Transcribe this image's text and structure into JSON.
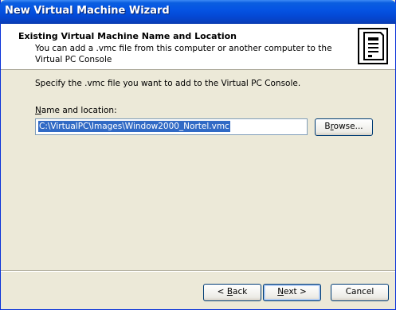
{
  "window": {
    "title": "New Virtual Machine Wizard"
  },
  "header": {
    "title": "Existing Virtual Machine Name and Location",
    "subtitle": "You can add a .vmc file from this computer or another computer to the Virtual PC Console",
    "icon": "computer-tower-icon"
  },
  "main": {
    "instruction": "Specify the .vmc file you want to add to the Virtual PC Console.",
    "field_label": "Name and location:",
    "path_value": "C:\\VirtualPC\\Images\\Window2000_Nortel.vmc",
    "browse_label": "Browse..."
  },
  "footer": {
    "back_label": "< Back",
    "next_label": "Next >",
    "cancel_label": "Cancel"
  },
  "colors": {
    "titlebar": "#0554e3",
    "window_bg": "#ece9d8",
    "selection": "#316ac5"
  }
}
